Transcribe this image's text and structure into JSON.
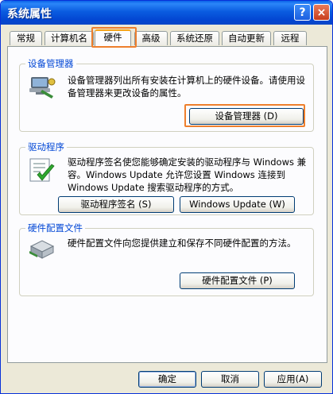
{
  "window": {
    "title": "系统属性",
    "help_button": "?",
    "close_button": "×"
  },
  "tabs": [
    {
      "label": "常规",
      "active": false
    },
    {
      "label": "计算机名",
      "active": false
    },
    {
      "label": "硬件",
      "active": true
    },
    {
      "label": "高级",
      "active": false
    },
    {
      "label": "系统还原",
      "active": false
    },
    {
      "label": "自动更新",
      "active": false
    },
    {
      "label": "远程",
      "active": false
    }
  ],
  "device_manager": {
    "group_label": "设备管理器",
    "icon": "device-manager-icon",
    "description": "设备管理器列出所有安装在计算机上的硬件设备。请使用设备管理器来更改设备的属性。",
    "button_label": "设备管理器 (D)"
  },
  "drivers": {
    "group_label": "驱动程序",
    "icon": "driver-signing-icon",
    "description": "驱动程序签名使您能够确定安装的驱动程序与 Windows 兼容。Windows Update 允许您设置 Windows 连接到 Windows Update 搜索驱动程序的方式。",
    "signing_button_label": "驱动程序签名 (S)",
    "update_button_label": "Windows Update (W)"
  },
  "hardware_profiles": {
    "group_label": "硬件配置文件",
    "icon": "hardware-profile-icon",
    "description": "硬件配置文件向您提供建立和保存不同硬件配置的方法。",
    "button_label": "硬件配置文件 (P)"
  },
  "footer": {
    "ok_label": "确定",
    "cancel_label": "取消",
    "apply_label": "应用(A)"
  },
  "colors": {
    "titlebar": "#0a5ce0",
    "highlight": "#ee7f2d",
    "group_label": "#0046d5",
    "dialog_bg": "#ece9d8"
  }
}
